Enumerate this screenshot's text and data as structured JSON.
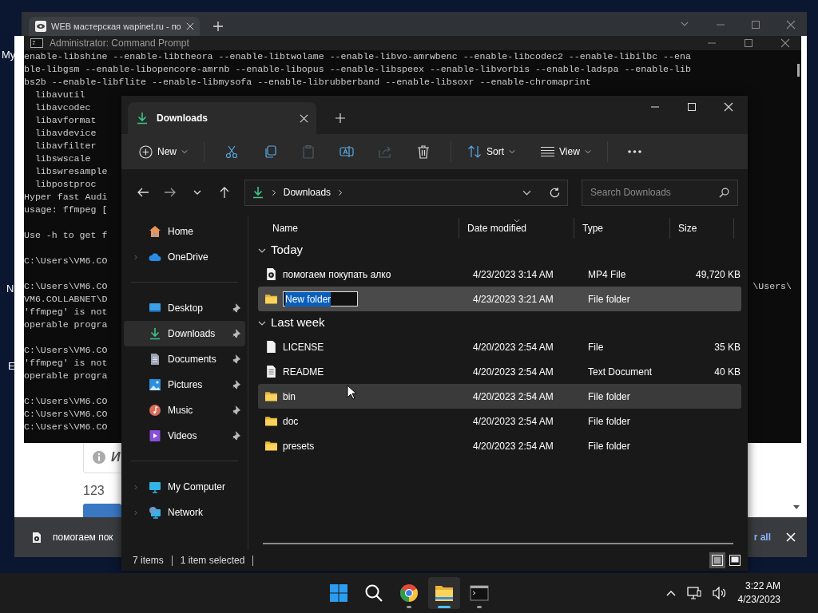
{
  "desktop": {
    "icon_labels": [
      "My",
      "N",
      "E"
    ]
  },
  "browser": {
    "tab": {
      "title": "WEB мастерская wapinet.ru - по",
      "selected": true
    },
    "info_text": "И",
    "value_text": "123",
    "download_bar": {
      "file_name": "помогаем пок",
      "link": "r all"
    }
  },
  "cmd": {
    "title": "Administrator: Command Prompt",
    "blocks": [
      [
        {
          "text": "enable-libshine --enable-libtheora --enable-libtwolame --enable-libvo-amrwbenc --enable-libcodec2 --enable-libilbc --ena"
        },
        {
          "text": "ble-libgsm --enable-libopencore-amrnb --enable-libopus --enable-libspeex --enable-libvorbis --enable-ladspa --enable-lib"
        },
        {
          "text": "bs2b --enable-libflite --enable-libmysofa --enable-librubberband --enable-libsoxr --enable-chromaprint"
        },
        {
          "text": "  libavutil"
        },
        {
          "text": "  libavcodec"
        },
        {
          "text": "  libavformat"
        },
        {
          "text": "  libavdevice"
        },
        {
          "text": "  libavfilter"
        },
        {
          "text": "  libswscale"
        },
        {
          "text": "  libswresample"
        },
        {
          "text": "  libpostproc"
        },
        {
          "text": "Hyper fast Audi"
        },
        {
          "text": "usage: ffmpeg ["
        }
      ],
      [
        {
          "text": "Use -h to get f"
        }
      ],
      [
        {
          "text": "C:\\Users\\VM6.CO"
        }
      ],
      [
        {
          "text": "C:\\Users\\VM6.CO",
          "tail": "\\Users\\"
        },
        {
          "text": "VM6.COLLABNET\\D"
        },
        {
          "text": "'ffmpeg' is not"
        },
        {
          "text": "operable progra"
        }
      ],
      [
        {
          "text": "C:\\Users\\VM6.CO"
        },
        {
          "text": "'ffmpeg' is not"
        },
        {
          "text": "operable progra"
        }
      ],
      [
        {
          "text": "C:\\Users\\VM6.CO"
        },
        {
          "text": "C:\\Users\\VM6.CO"
        },
        {
          "text": "C:\\Users\\VM6.CO"
        }
      ]
    ]
  },
  "explorer": {
    "tabs": [
      {
        "label": "Downloads",
        "selected": true
      }
    ],
    "toolbar": {
      "new_label": "New",
      "actions": [
        {
          "disabled": false
        },
        {
          "disabled": false
        },
        {
          "disabled": true
        },
        {
          "disabled": false
        },
        {
          "disabled": true
        },
        {
          "disabled": false
        }
      ],
      "sort_label": "Sort",
      "view_label": "View"
    },
    "address": {
      "path": "Downloads",
      "search_placeholder": "Search Downloads"
    },
    "sidebar": [
      [
        {
          "kind": "home",
          "label": "Home",
          "expandable": false,
          "pinned": false,
          "selected": false
        },
        {
          "kind": "cloud",
          "label": "OneDrive",
          "expandable": true,
          "pinned": false,
          "selected": false
        }
      ],
      [
        {
          "kind": "desktop",
          "label": "Desktop",
          "expandable": false,
          "pinned": true,
          "selected": false
        },
        {
          "kind": "downloads",
          "label": "Downloads",
          "expandable": false,
          "pinned": true,
          "selected": true
        },
        {
          "kind": "documents",
          "label": "Documents",
          "expandable": false,
          "pinned": true,
          "selected": false
        },
        {
          "kind": "pictures",
          "label": "Pictures",
          "expandable": false,
          "pinned": true,
          "selected": false
        },
        {
          "kind": "music",
          "label": "Music",
          "expandable": false,
          "pinned": true,
          "selected": false
        },
        {
          "kind": "videos",
          "label": "Videos",
          "expandable": false,
          "pinned": true,
          "selected": false
        }
      ],
      [
        {
          "kind": "computer",
          "label": "My Computer",
          "expandable": true,
          "pinned": false,
          "selected": false
        },
        {
          "kind": "network",
          "label": "Network",
          "expandable": true,
          "pinned": false,
          "selected": false
        }
      ]
    ],
    "columns": [
      {
        "label": "Name",
        "sorted": false
      },
      {
        "label": "Date modified",
        "sorted": true
      },
      {
        "label": "Type",
        "sorted": false
      },
      {
        "label": "Size",
        "sorted": false
      }
    ],
    "groups": [
      {
        "label": "Today",
        "expanded": true,
        "rows": [
          {
            "kind": "video",
            "name": "помогаем покупать алко",
            "date": "4/23/2023 3:14 AM",
            "type": "MP4 File",
            "size": "49,720 KB",
            "selected": false,
            "hovered": false,
            "editing": false
          },
          {
            "kind": "folder",
            "name": "New folder",
            "date": "4/23/2023 3:21 AM",
            "type": "File folder",
            "selected": true,
            "hovered": false,
            "editing": true
          }
        ]
      },
      {
        "label": "Last week",
        "expanded": true,
        "rows": [
          {
            "kind": "file",
            "name": "LICENSE",
            "date": "4/20/2023 2:54 AM",
            "type": "File",
            "size": "35 KB",
            "selected": false,
            "hovered": false,
            "editing": false
          },
          {
            "kind": "text",
            "name": "README",
            "date": "4/20/2023 2:54 AM",
            "type": "Text Document",
            "size": "40 KB",
            "selected": false,
            "hovered": false,
            "editing": false
          },
          {
            "kind": "folder",
            "name": "bin",
            "date": "4/20/2023 2:54 AM",
            "type": "File folder",
            "selected": false,
            "hovered": true,
            "editing": false
          },
          {
            "kind": "folder",
            "name": "doc",
            "date": "4/20/2023 2:54 AM",
            "type": "File folder",
            "selected": false,
            "hovered": false,
            "editing": false
          },
          {
            "kind": "folder",
            "name": "presets",
            "date": "4/20/2023 2:54 AM",
            "type": "File folder",
            "selected": false,
            "hovered": false,
            "editing": false
          }
        ]
      }
    ],
    "status": {
      "count": "7 items",
      "selection": "1 item selected"
    },
    "view_modes": [
      {
        "selected": true
      },
      {
        "selected": false
      }
    ]
  },
  "taskbar": {
    "apps": [
      {
        "kind": "start",
        "running": false,
        "active": false
      },
      {
        "kind": "search",
        "running": false,
        "active": false
      },
      {
        "kind": "browser",
        "running": true,
        "active": false
      },
      {
        "kind": "explorer",
        "running": true,
        "active": true
      },
      {
        "kind": "terminal",
        "running": true,
        "active": false
      }
    ],
    "time": "3:22 AM",
    "date": "4/23/2023"
  }
}
